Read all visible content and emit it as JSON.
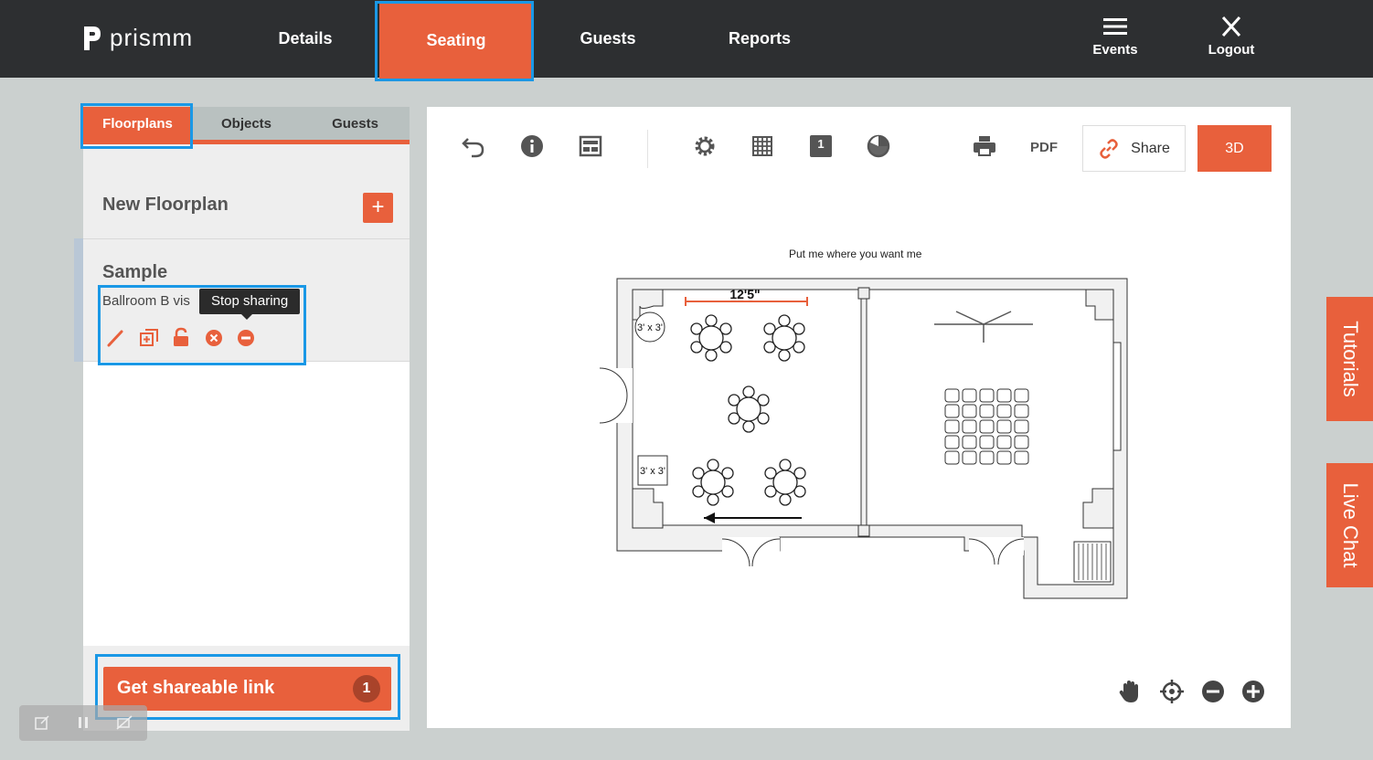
{
  "app": {
    "logo_text": "prismm"
  },
  "nav": {
    "items": [
      {
        "label": "Details"
      },
      {
        "label": "Seating"
      },
      {
        "label": "Guests"
      },
      {
        "label": "Reports"
      }
    ],
    "active": "Seating",
    "events_label": "Events",
    "logout_label": "Logout"
  },
  "left_panel": {
    "tabs": [
      {
        "label": "Floorplans"
      },
      {
        "label": "Objects"
      },
      {
        "label": "Guests"
      }
    ],
    "active_tab": "Floorplans",
    "new_floorplan_label": "New Floorplan",
    "plan": {
      "name": "Sample",
      "description": "Ballroom B vis"
    },
    "tooltip": "Stop sharing",
    "share_button": {
      "label": "Get shareable link",
      "count": "1"
    }
  },
  "toolbar": {
    "pdf_label": "PDF",
    "share_label": "Share",
    "view3d_label": "3D",
    "page_number": "1"
  },
  "floorplan": {
    "caption": "Put me where you want me",
    "dimension_label": "12'5\"",
    "object_label_1": "3' x 3'",
    "object_label_2": "3' x 3'"
  },
  "side_tabs": {
    "tutorials": "Tutorials",
    "live_chat": "Live Chat"
  },
  "colors": {
    "accent": "#e8603c",
    "topbar": "#2d2f31",
    "highlight": "#1a98e6"
  }
}
